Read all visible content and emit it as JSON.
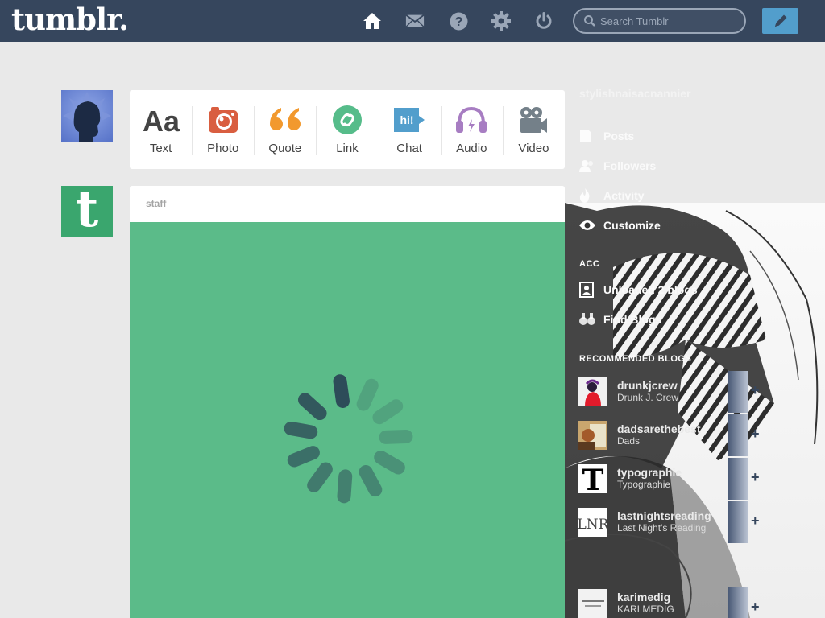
{
  "header": {
    "logo": "tumblr.",
    "nav": [
      "home-icon",
      "mail-icon",
      "help-icon",
      "gear-icon",
      "power-icon"
    ],
    "search_placeholder": "Search Tumblr",
    "compose_icon": "pencil-icon"
  },
  "post_types": [
    {
      "label": "Text",
      "icon": "text-icon",
      "color": "#444444"
    },
    {
      "label": "Photo",
      "icon": "camera-icon",
      "color": "#d95e40"
    },
    {
      "label": "Quote",
      "icon": "quote-icon",
      "color": "#f2992e"
    },
    {
      "label": "Link",
      "icon": "link-icon",
      "color": "#56bc8a"
    },
    {
      "label": "Chat",
      "icon": "chat-icon",
      "color": "#529ecc"
    },
    {
      "label": "Audio",
      "icon": "headphones-icon",
      "color": "#a77dc2"
    },
    {
      "label": "Video",
      "icon": "video-camera-icon",
      "color": "#748089"
    }
  ],
  "post": {
    "author": "staff",
    "media_color": "#5bbb89",
    "avatar_letter": "t"
  },
  "sidebar": {
    "blog_name": "stylishnaisacnannier",
    "items": [
      {
        "label": "Posts",
        "icon": "document-icon"
      },
      {
        "label": "Followers",
        "icon": "people-icon"
      },
      {
        "label": "Activity",
        "icon": "flame-icon"
      },
      {
        "label": "Customize",
        "icon": "eye-icon"
      }
    ],
    "section_account": "ACC",
    "account_items": [
      {
        "label": "Unloaded 2 blogs",
        "icon": "contact-card-icon"
      },
      {
        "label": "Find Blogs",
        "icon": "binoculars-icon"
      }
    ],
    "section_recommended": "RECOMMENDED BLOGS",
    "recommended": [
      {
        "name": "drunkjcrew",
        "sub": "Drunk J. Crew",
        "avatar": "red-figure"
      },
      {
        "name": "dadsarethebest",
        "sub": "Dads",
        "avatar": "photo"
      },
      {
        "name": "typographie",
        "sub": "Typographie",
        "avatar": "T"
      },
      {
        "name": "lastnightsreading",
        "sub": "Last Night's Reading",
        "avatar": "LNR"
      },
      {
        "name": "karimedig",
        "sub": "KARI MEDIG",
        "avatar": "logo"
      }
    ]
  }
}
